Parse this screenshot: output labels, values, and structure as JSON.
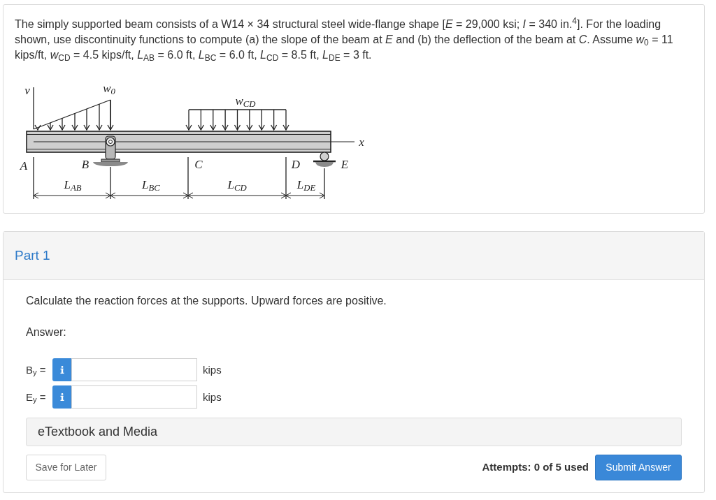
{
  "problem": {
    "text": "The simply supported beam consists of a W14 × 34 structural steel wide-flange shape [*E* = 29,000 ksi; *I* = 340 in.$^{4}$].  For the loading shown, use discontinuity functions to compute (a) the slope of the beam at *E* and (b) the deflection of the beam at *C*.  Assume *w*$_{0}$ = 11 kips/ft, *w*$_{CD}$ = 4.5 kips/ft, *L*$_{AB}$ = 6.0 ft, *L*$_{BC}$ = 6.0 ft, *L*$_{CD}$ = 8.5 ft, *L*$_{DE}$ = 3 ft."
  },
  "figure": {
    "vertical_axis": "v",
    "horizontal_axis": "x",
    "triangular_load": "w$_{0}$",
    "uniform_load": "w$_{CD}$",
    "points": [
      "A",
      "B",
      "C",
      "D",
      "E"
    ],
    "spans": [
      "L$_{AB}$",
      "L$_{BC}$",
      "L$_{CD}$",
      "L$_{DE}$"
    ]
  },
  "part": {
    "title": "Part 1",
    "instruction": "Calculate the reaction forces at the supports. Upward forces are positive.",
    "answer_label": "Answer:",
    "answers": [
      {
        "label": "B$_{y}$ =",
        "unit": "kips"
      },
      {
        "label": "E$_{y}$ =",
        "unit": "kips"
      }
    ],
    "resources": "eTextbook and Media",
    "save_button": "Save for Later",
    "attempts": "Attempts: 0 of 5 used",
    "submit_button": "Submit Answer"
  }
}
